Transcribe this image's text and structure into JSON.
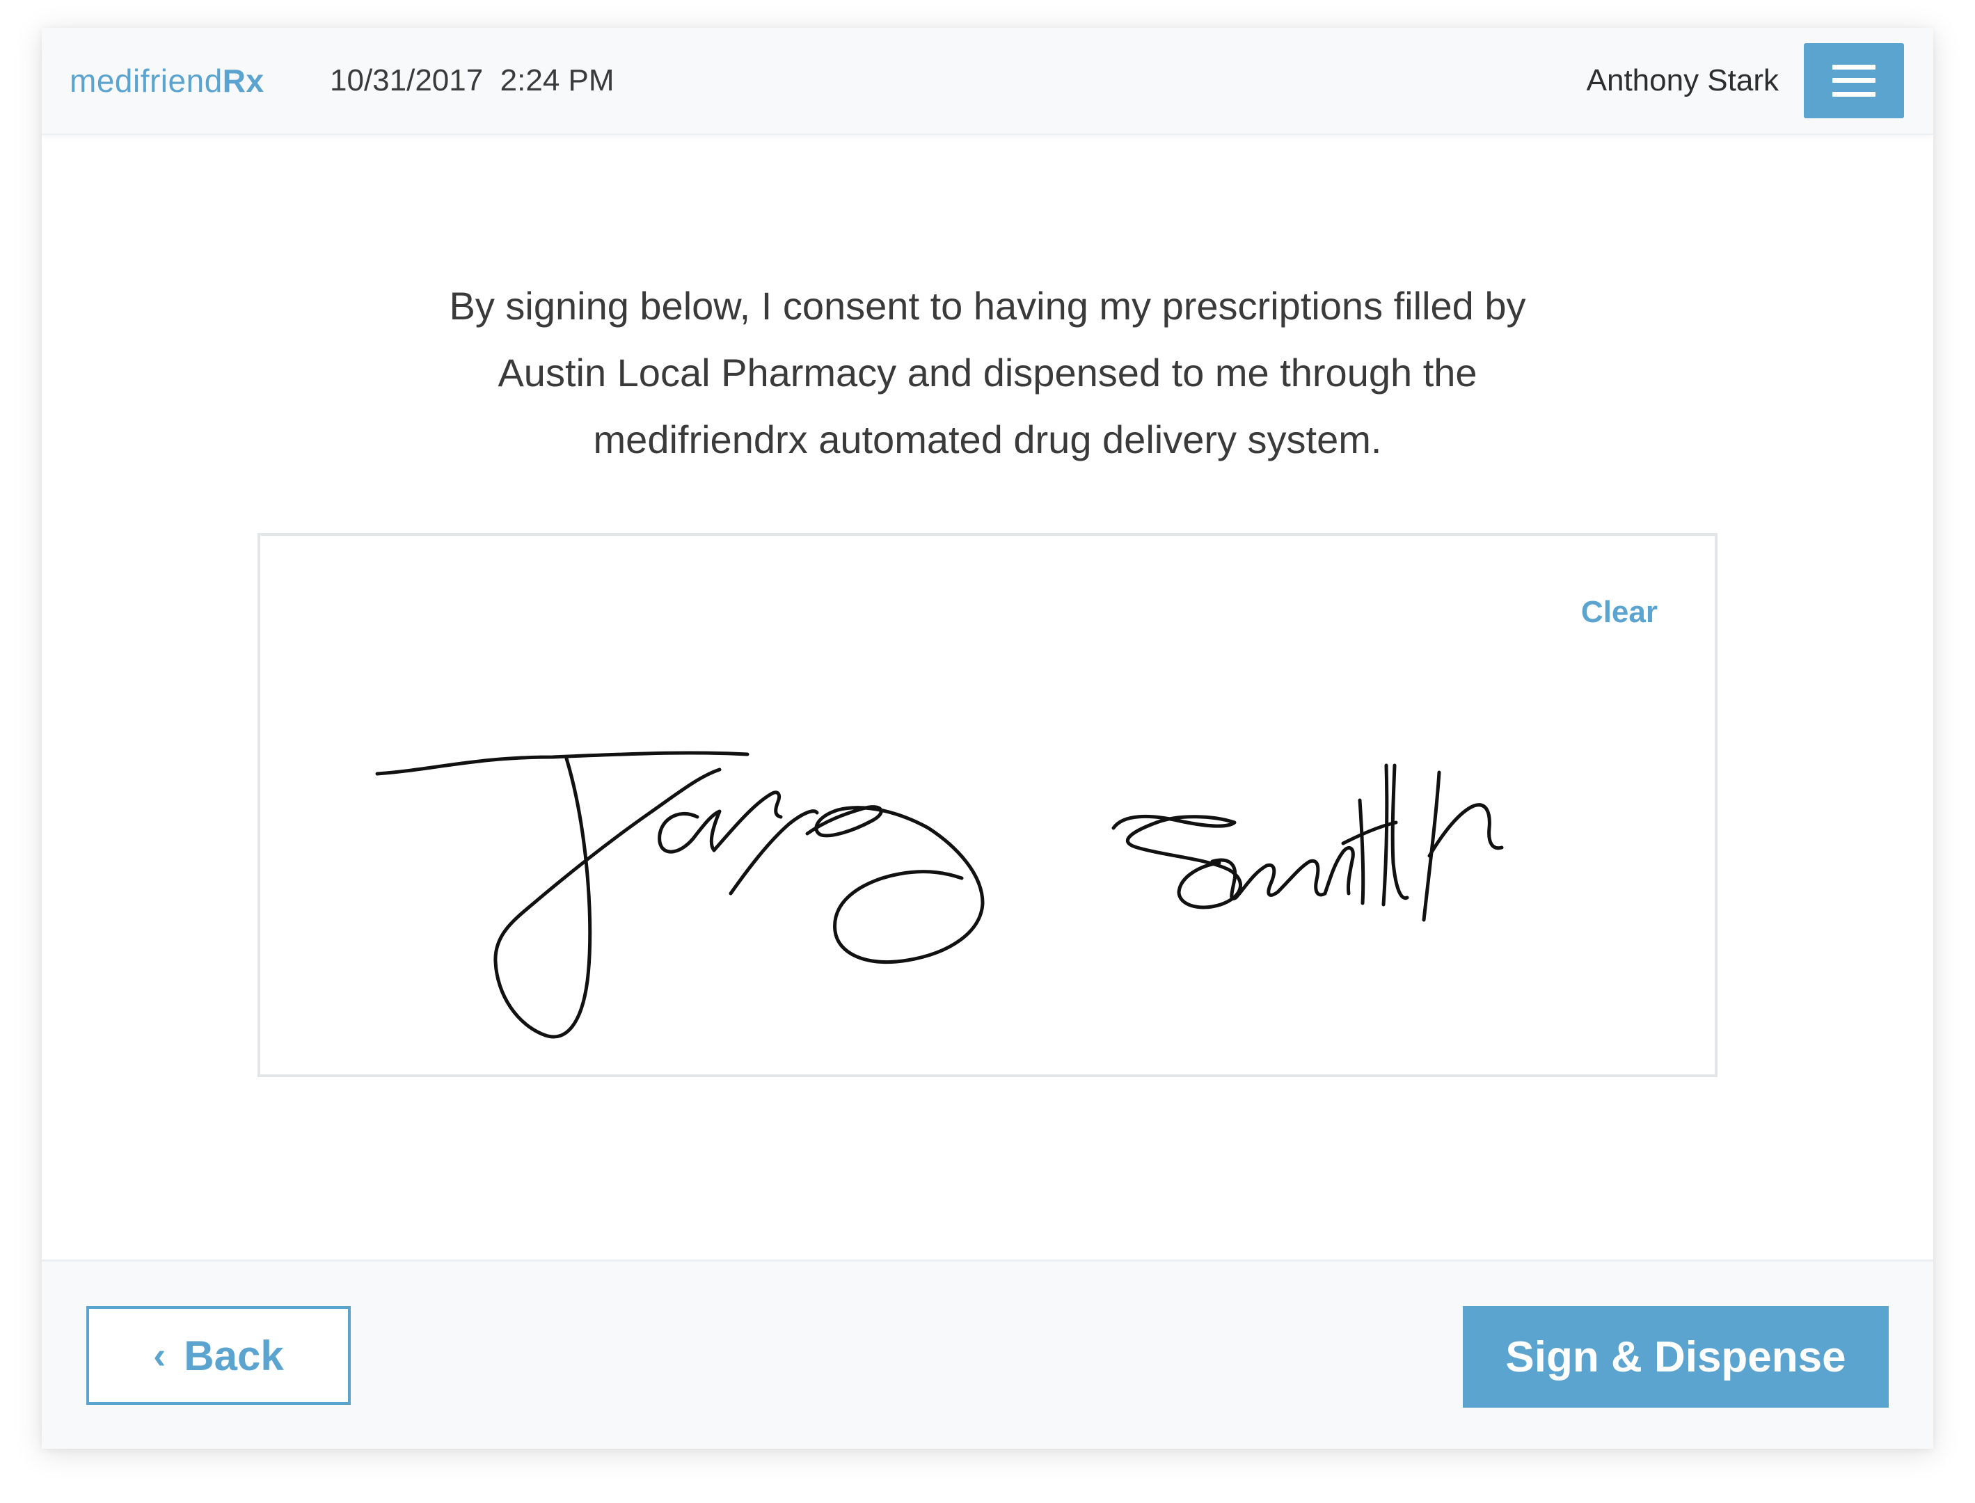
{
  "header": {
    "brand_prefix": "medifriend",
    "brand_suffix": "Rx",
    "date": "10/31/2017",
    "time": "2:24 PM",
    "user_name": "Anthony Stark",
    "menu_icon": "hamburger-menu-icon"
  },
  "consent": {
    "line1": "By signing below, I consent to having my prescriptions filled by",
    "line2": "Austin Local Pharmacy and dispensed to me through the",
    "line3": "medifriendrx automated drug delivery system."
  },
  "signature_pad": {
    "clear_label": "Clear",
    "signature_name": "James Smith"
  },
  "footer": {
    "back_label": "Back",
    "back_icon": "chevron-left-icon",
    "sign_label": "Sign & Dispense"
  },
  "colors": {
    "accent": "#5ba4cf",
    "header_bg": "#f7f9fa",
    "text": "#3a3a3a",
    "border": "#e3e6e8"
  }
}
